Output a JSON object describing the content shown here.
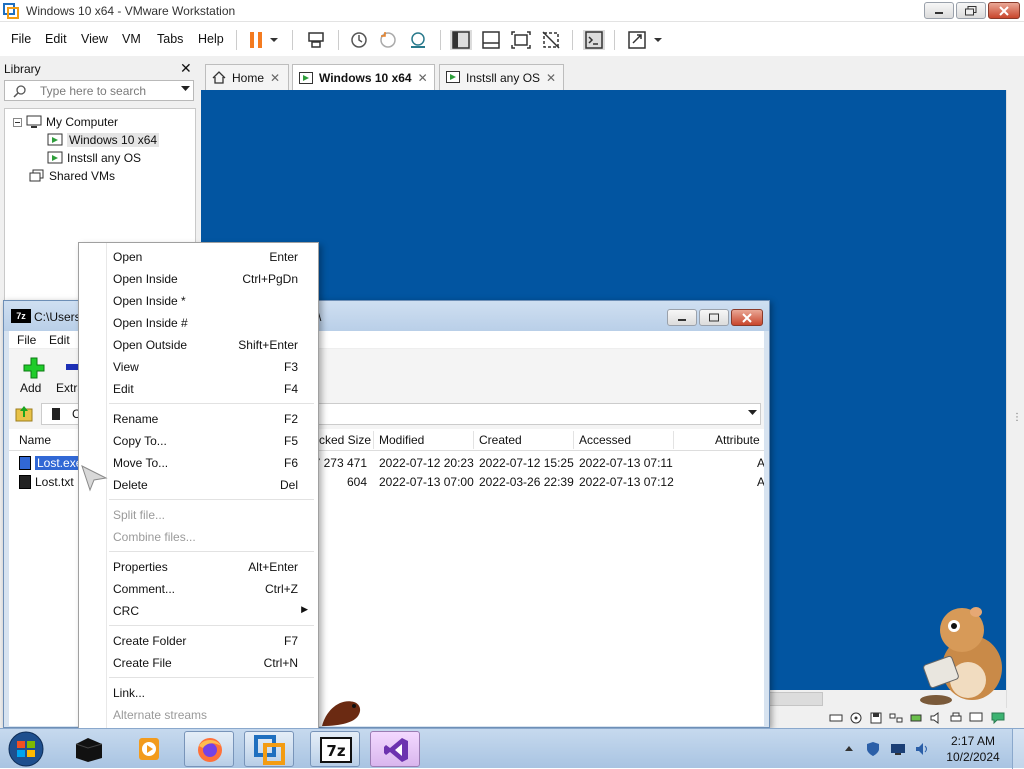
{
  "window": {
    "title": "Windows 10 x64 - VMware Workstation"
  },
  "menubar": {
    "items": [
      "File",
      "Edit",
      "View",
      "VM",
      "Tabs",
      "Help"
    ]
  },
  "library": {
    "title": "Library",
    "search_placeholder": "Type here to search",
    "tree": [
      {
        "label": "My Computer"
      },
      {
        "label": "Windows 10 x64"
      },
      {
        "label": "Instsll any OS"
      },
      {
        "label": "Shared VMs"
      }
    ]
  },
  "tabs": [
    {
      "label": "Home"
    },
    {
      "label": "Windows 10 x64"
    },
    {
      "label": "Instsll any OS"
    }
  ],
  "sevenzip": {
    "title": "C:\\Users\\",
    "title_suffix": "\\",
    "menu": [
      "File",
      "Edit"
    ],
    "toolbar": {
      "add": "Add",
      "extract": "Extra"
    },
    "address": "C:",
    "columns": [
      "Name",
      "cked Size",
      "Modified",
      "Created",
      "Accessed",
      "Attribute"
    ],
    "files": [
      {
        "name": "Lost.exe",
        "packed": "7 273 471",
        "modified": "2022-07-12 20:23",
        "created": "2022-07-12 15:25",
        "accessed": "2022-07-13 07:11",
        "attr": "A"
      },
      {
        "name": "Lost.txt",
        "packed": "604",
        "modified": "2022-07-13 07:00",
        "created": "2022-03-26 22:39",
        "accessed": "2022-07-13 07:12",
        "attr": "A"
      }
    ]
  },
  "context_menu": {
    "groups": [
      [
        {
          "label": "Open",
          "shortcut": "Enter"
        },
        {
          "label": "Open Inside",
          "shortcut": "Ctrl+PgDn"
        },
        {
          "label": "Open Inside *",
          "shortcut": ""
        },
        {
          "label": "Open Inside #",
          "shortcut": ""
        },
        {
          "label": "Open Outside",
          "shortcut": "Shift+Enter"
        },
        {
          "label": "View",
          "shortcut": "F3"
        },
        {
          "label": "Edit",
          "shortcut": "F4"
        }
      ],
      [
        {
          "label": "Rename",
          "shortcut": "F2"
        },
        {
          "label": "Copy To...",
          "shortcut": "F5"
        },
        {
          "label": "Move To...",
          "shortcut": "F6"
        },
        {
          "label": "Delete",
          "shortcut": "Del"
        }
      ],
      [
        {
          "label": "Split file...",
          "shortcut": "",
          "disabled": true
        },
        {
          "label": "Combine files...",
          "shortcut": "",
          "disabled": true
        }
      ],
      [
        {
          "label": "Properties",
          "shortcut": "Alt+Enter"
        },
        {
          "label": "Comment...",
          "shortcut": "Ctrl+Z"
        },
        {
          "label": "CRC",
          "shortcut": "",
          "submenu": true
        }
      ],
      [
        {
          "label": "Create Folder",
          "shortcut": "F7"
        },
        {
          "label": "Create File",
          "shortcut": "Ctrl+N"
        }
      ],
      [
        {
          "label": "Link...",
          "shortcut": ""
        },
        {
          "label": "Alternate streams",
          "shortcut": "",
          "disabled": true
        }
      ]
    ]
  },
  "taskbar": {
    "clock_time": "2:17 AM",
    "clock_date": "10/2/2024",
    "apps": [
      "start-orb",
      "black-box-app",
      "media-player",
      "firefox",
      "vmware-workstation",
      "7-zip",
      "visual-studio"
    ]
  },
  "colors": {
    "guest_desktop": "#0255a1",
    "selection": "#3168d5",
    "taskbar_active": "#d9b6ee"
  }
}
